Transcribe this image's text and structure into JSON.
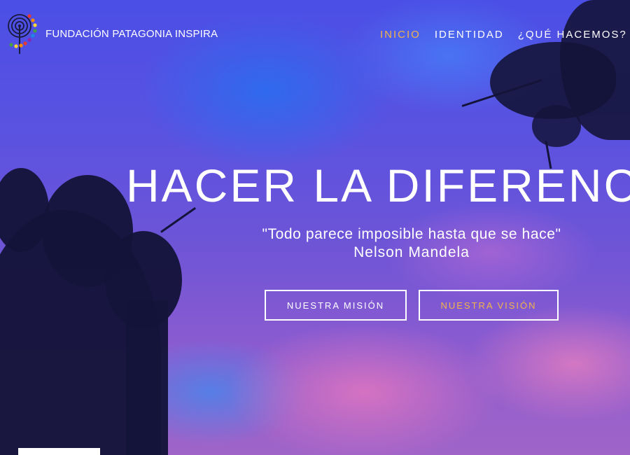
{
  "header": {
    "brand": "FUNDACIÓN PATAGONIA INSPIRA",
    "nav": [
      {
        "label": "INICIO",
        "active": true
      },
      {
        "label": "IDENTIDAD",
        "active": false
      },
      {
        "label": "¿QUÉ HACEMOS?",
        "active": false
      }
    ]
  },
  "hero": {
    "title": "HACER LA DIFERENCIA",
    "quote": "\"Todo parece imposible hasta que se hace\"",
    "author": "Nelson Mandela",
    "buttons": {
      "mision": "NUESTRA MISIÓN",
      "vision": "NUESTRA VISIÓN"
    }
  },
  "colors": {
    "accent": "#f2b44a",
    "text": "#ffffff"
  },
  "icons": {
    "logo": "spiral-logo-icon"
  }
}
